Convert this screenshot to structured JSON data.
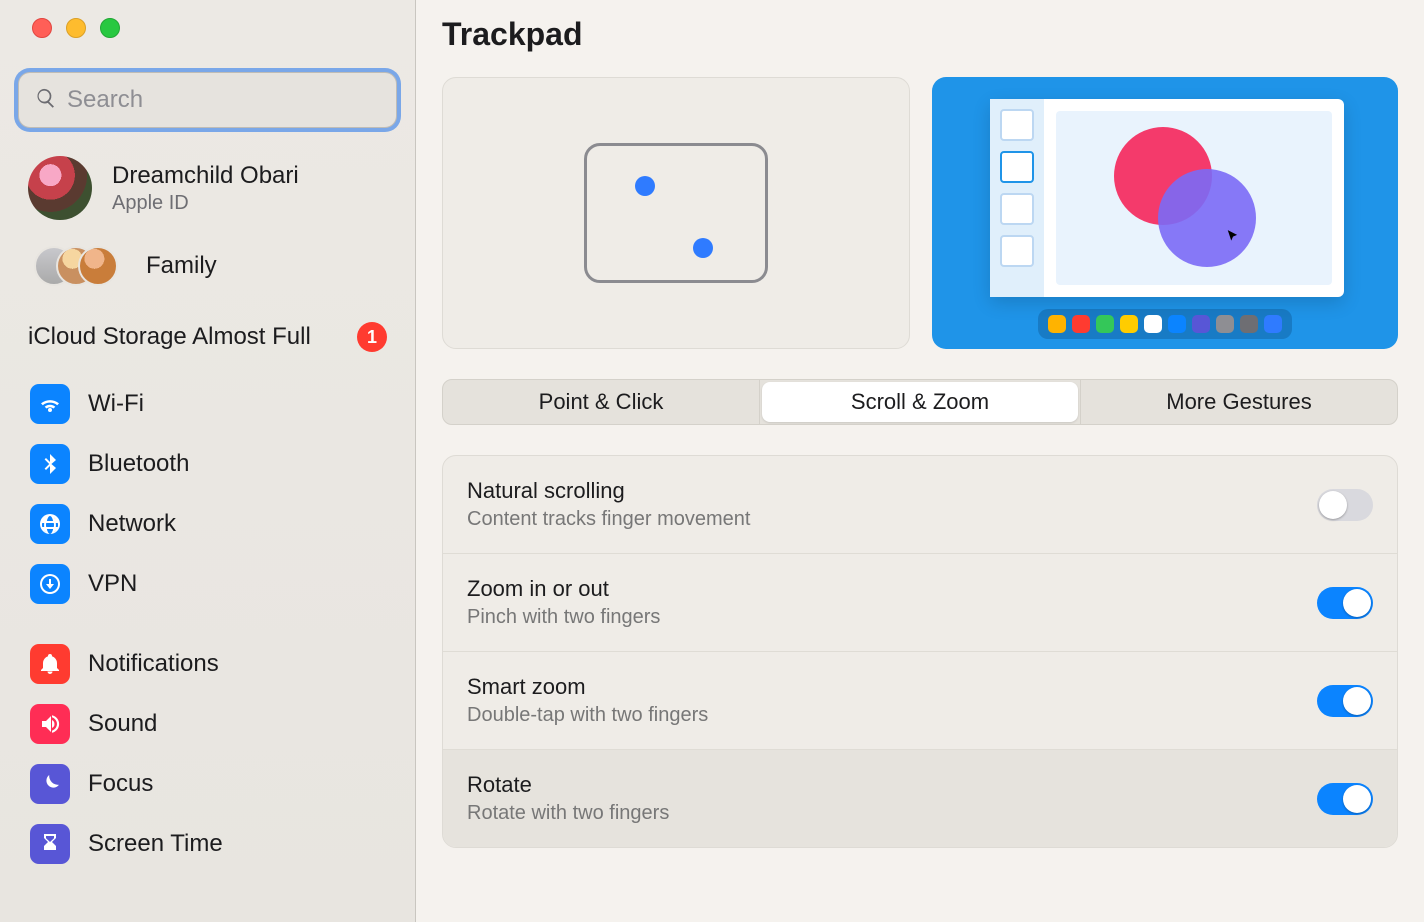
{
  "search": {
    "placeholder": "Search"
  },
  "account": {
    "name": "Dreamchild Obari",
    "sub": "Apple ID"
  },
  "family": {
    "label": "Family"
  },
  "alert": {
    "text": "iCloud Storage Almost Full",
    "badge": "1"
  },
  "sidebar": {
    "groups": [
      {
        "items": [
          {
            "label": "Wi-Fi"
          },
          {
            "label": "Bluetooth"
          },
          {
            "label": "Network"
          },
          {
            "label": "VPN"
          }
        ]
      },
      {
        "items": [
          {
            "label": "Notifications"
          },
          {
            "label": "Sound"
          },
          {
            "label": "Focus"
          },
          {
            "label": "Screen Time"
          }
        ]
      }
    ]
  },
  "page": {
    "title": "Trackpad"
  },
  "tabs": {
    "items": [
      {
        "label": "Point & Click"
      },
      {
        "label": "Scroll & Zoom"
      },
      {
        "label": "More Gestures"
      }
    ],
    "active_index": 1
  },
  "settings": [
    {
      "title": "Natural scrolling",
      "subtitle": "Content tracks finger movement",
      "on": false
    },
    {
      "title": "Zoom in or out",
      "subtitle": "Pinch with two fingers",
      "on": true
    },
    {
      "title": "Smart zoom",
      "subtitle": "Double-tap with two fingers",
      "on": true
    },
    {
      "title": "Rotate",
      "subtitle": "Rotate with two fingers",
      "on": true
    }
  ],
  "dock_colors": [
    "#ffb300",
    "#ff3b30",
    "#34c759",
    "#ffcc00",
    "#ffffff",
    "#0b84ff",
    "#5856d6",
    "#8e8e93",
    "#6e6e73",
    "#2f7bff"
  ]
}
